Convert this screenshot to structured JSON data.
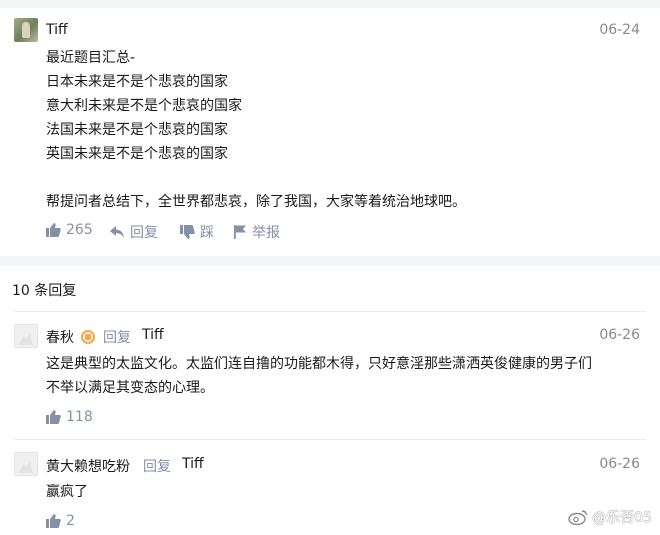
{
  "main_comment": {
    "author": "Tiff",
    "date": "06-24",
    "lines": [
      "最近题目汇总-",
      "日本未来是不是个悲哀的国家",
      "意大利未来是不是个悲哀的国家",
      "法国未来是不是个悲哀的国家",
      "英国未来是不是个悲哀的国家",
      "",
      "帮提问者总结下，全世界都悲哀，除了我国，大家等着统治地球吧。"
    ],
    "likes": "265",
    "reply_label": "回复",
    "dislike_label": "踩",
    "report_label": "举报"
  },
  "replies_header": {
    "count_text": "10 条回复"
  },
  "replies": [
    {
      "author": "春秋",
      "reply_tag": "回复",
      "reply_to": "Tiff",
      "date": "06-26",
      "lines": [
        "这是典型的太监文化。太监们连自撸的功能都木得，只好意淫那些潇洒英俊健康的男子们",
        "不举以满足其变态的心理。"
      ],
      "likes": "118"
    },
    {
      "author": "黄大赖想吃粉",
      "reply_tag": "回复",
      "reply_to": "Tiff",
      "date": "06-26",
      "lines": [
        "赢疯了"
      ],
      "likes": "2"
    }
  ],
  "watermark": {
    "text": "@乐否05"
  },
  "colors": {
    "accent_gray": "#8590a6",
    "divider": "#ebebeb",
    "section_bg": "#f4f5f7"
  }
}
